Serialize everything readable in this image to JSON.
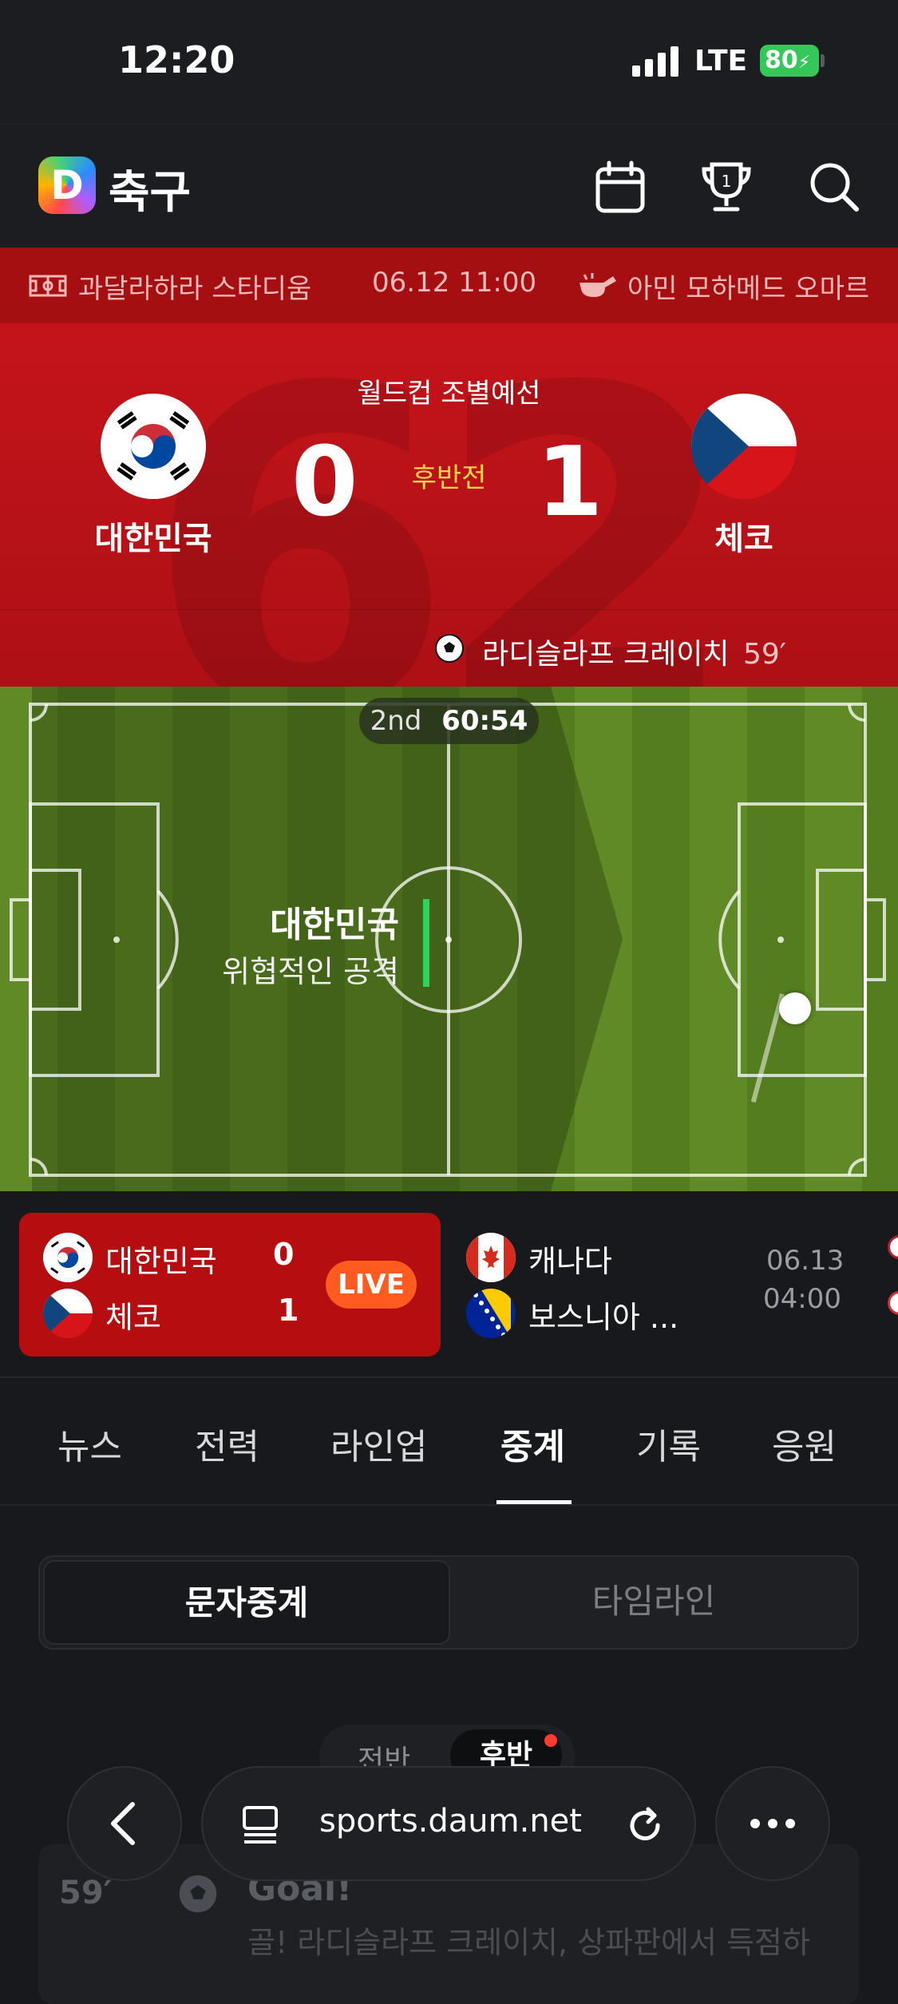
{
  "status_bar": {
    "time": "12:20",
    "network": "LTE",
    "battery": "80"
  },
  "app_bar": {
    "logo_letter": "D",
    "title": "축구",
    "icons": [
      "calendar-icon",
      "trophy-icon",
      "search-icon"
    ]
  },
  "match_info": {
    "stadium": "과달라하라 스타디움",
    "datetime": "06.12 11:00",
    "referee": "아민 모하메드 오마르"
  },
  "scoreboard": {
    "competition": "월드컵 조별예선",
    "period": "후반전",
    "home": {
      "name": "대한민국",
      "score": "0"
    },
    "away": {
      "name": "체코",
      "score": "1"
    },
    "goal_event": {
      "scorer": "라디슬라프 크레이치",
      "minute": "59′"
    }
  },
  "live_pitch": {
    "half": "2nd",
    "clock": "60:54",
    "team": "대한민국",
    "event": "위협적인 공격",
    "ball_position_x": 0.885,
    "ball_position_y": 0.41
  },
  "match_strip": [
    {
      "home": "대한민국",
      "home_score": "0",
      "away": "체코",
      "away_score": "1",
      "status": "LIVE"
    },
    {
      "home": "캐나다",
      "away": "보스니아 ...",
      "date": "06.13",
      "time": "04:00"
    }
  ],
  "tabs": [
    {
      "label": "뉴스",
      "active": false
    },
    {
      "label": "전력",
      "active": false
    },
    {
      "label": "라인업",
      "active": false
    },
    {
      "label": "중계",
      "active": true
    },
    {
      "label": "기록",
      "active": false
    },
    {
      "label": "응원",
      "active": false
    }
  ],
  "segment": {
    "options": [
      "문자중계",
      "타임라인"
    ],
    "selected": "문자중계"
  },
  "half_toggle": {
    "options": [
      "전반",
      "후반"
    ],
    "selected": "후반"
  },
  "commentary": [
    {
      "minute": "59′",
      "title": "Goal!",
      "text": "골! 라디슬라프 크레이치, 상파판에서 득점하"
    }
  ],
  "browser": {
    "url": "sports.daum.net"
  },
  "colors": {
    "accent_red": "#c4141a",
    "live_badge": "#ff5a1f",
    "pitch_green": "#5f8a25"
  }
}
